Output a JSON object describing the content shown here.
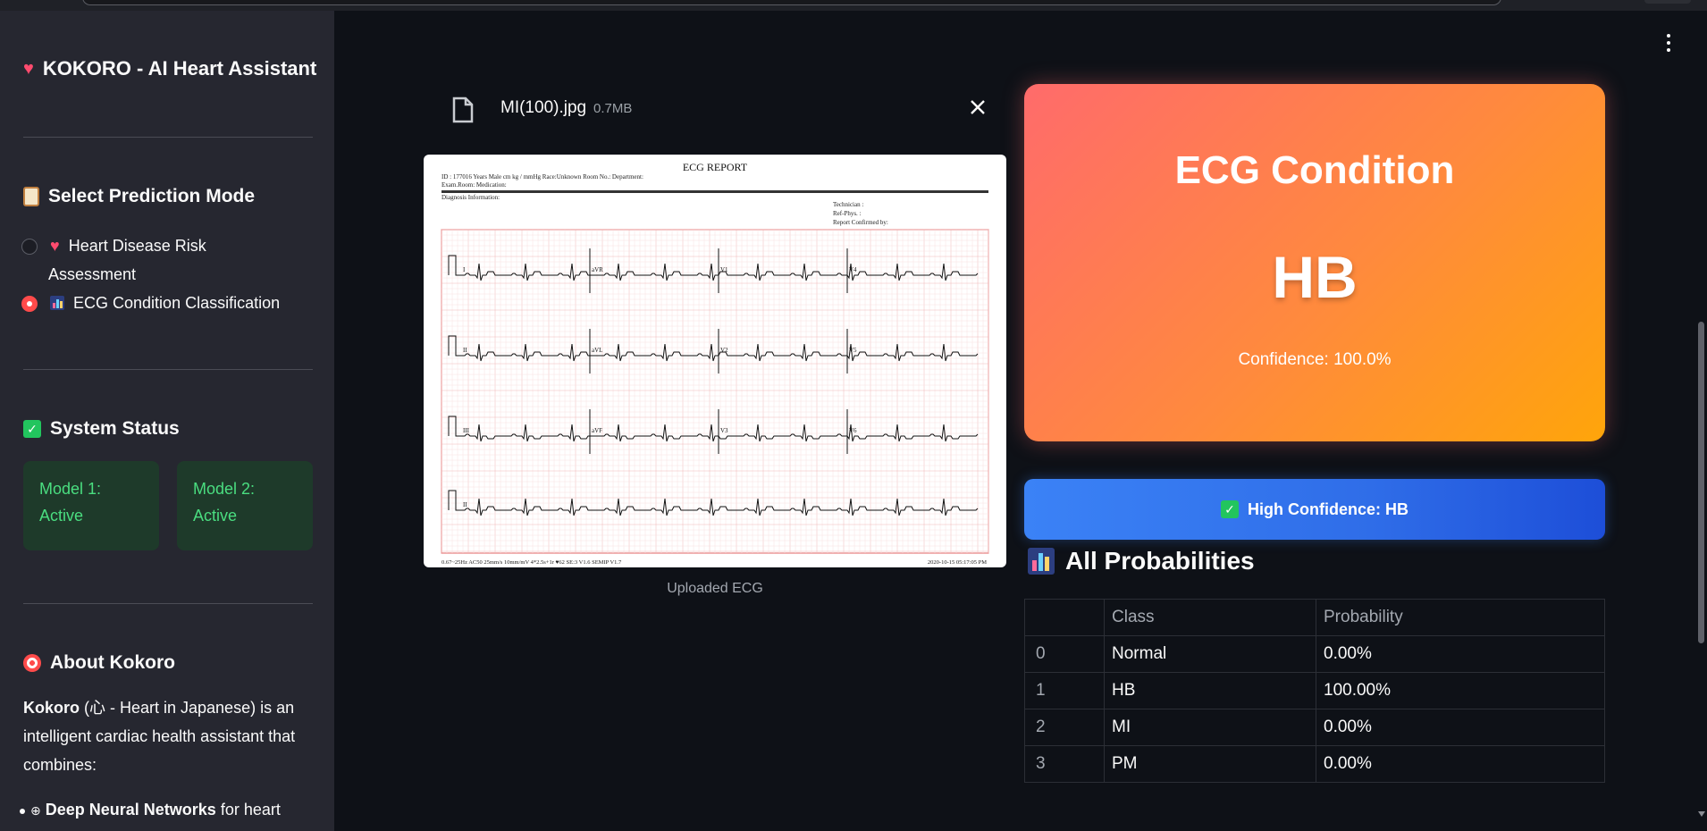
{
  "sidebar": {
    "app_title": "KOKORO - AI Heart Assistant",
    "mode_section_title": "Select Prediction Mode",
    "modes": [
      {
        "label_line1": "Heart Disease Risk",
        "label_line2": "Assessment",
        "selected": false,
        "icon": "heart-icon"
      },
      {
        "label_line1": "ECG Condition Classification",
        "label_line2": "",
        "selected": true,
        "icon": "bar-chart-icon"
      }
    ],
    "status_section_title": "System Status",
    "status": [
      {
        "line1": "Model 1:",
        "line2": "Active"
      },
      {
        "line1": "Model 2:",
        "line2": "Active"
      }
    ],
    "about_title": "About Kokoro",
    "about_brand": "Kokoro",
    "about_rest": " (心 - Heart in Japanese) is an intelligent cardiac health assistant that combines:",
    "bullet_bold": "Deep Neural Networks",
    "bullet_rest": " for heart"
  },
  "upload": {
    "file_name": "MI(100).jpg",
    "file_size": "0.7MB",
    "caption": "Uploaded ECG"
  },
  "ecg_report": {
    "title": "ECG  REPORT",
    "header_line1": "ID : 177016        Years    Male       cm         kg          /     mmHg     Race:Unknown      Room No.:      Department:",
    "header_line2": "Exam.Room:     Medication:",
    "diagnosis": "Diagnosis Information:",
    "tech1": "Technician :",
    "tech2": "Ref-Phys. :",
    "tech3": "Report Confirmed by:",
    "footer_left": "0.67~25Hz  AC50  25mm/s  10mm/mV  4*2.5s+1r  ♥62    SE:3 V1.6  SEMIP  V1.7",
    "footer_right": "2020-10-15   05:17:05 PM",
    "leads": [
      "I",
      "aVR",
      "V1",
      "V4",
      "II",
      "aVL",
      "V2",
      "V5",
      "III",
      "aVF",
      "V3",
      "V6",
      "II"
    ]
  },
  "result": {
    "card_title": "ECG Condition",
    "prediction": "HB",
    "confidence_text": "Confidence: 100.0%",
    "high_conf_text": "High Confidence: HB",
    "colors": {
      "card_start": "#ff6b6b",
      "card_end": "#ffa50a",
      "banner": "#3b82f6"
    }
  },
  "probabilities": {
    "title": "All Probabilities",
    "columns": [
      "",
      "Class",
      "Probability"
    ],
    "rows": [
      {
        "idx": "0",
        "class": "Normal",
        "prob": "0.00%"
      },
      {
        "idx": "1",
        "class": "HB",
        "prob": "100.00%"
      },
      {
        "idx": "2",
        "class": "MI",
        "prob": "0.00%"
      },
      {
        "idx": "3",
        "class": "PM",
        "prob": "0.00%"
      }
    ]
  }
}
